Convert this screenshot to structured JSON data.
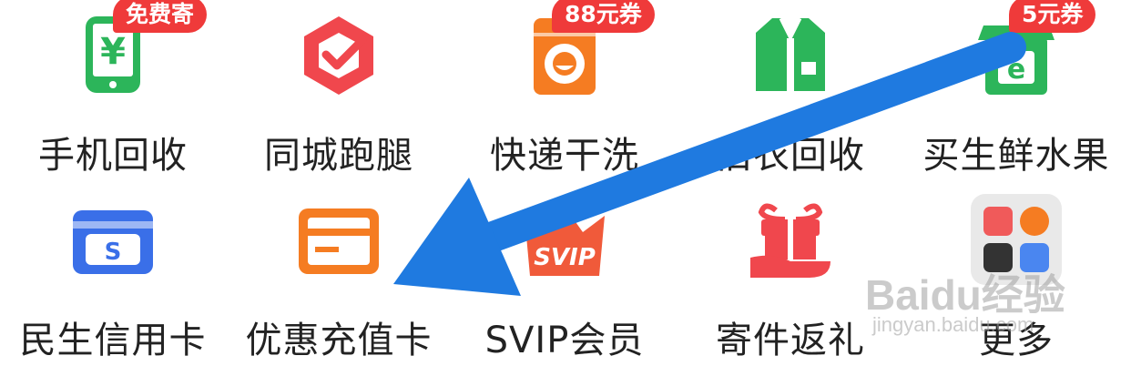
{
  "grid": {
    "items": [
      {
        "label": "手机回收",
        "badge": "免费寄",
        "icon": "phone-yuan-icon",
        "color": "#2cb55a"
      },
      {
        "label": "同城跑腿",
        "badge": "",
        "icon": "hexagon-check-icon",
        "color": "#f0474d"
      },
      {
        "label": "快递干洗",
        "badge": "88元券",
        "icon": "washing-machine-icon",
        "color": "#f57c22"
      },
      {
        "label": "旧衣回收",
        "badge": "",
        "icon": "shirt-icon",
        "color": "#2cb55a"
      },
      {
        "label": "买生鲜水果",
        "badge": "5元券",
        "icon": "fresh-bag-icon",
        "color": "#2cb55a"
      },
      {
        "label": "民生信用卡",
        "badge": "",
        "icon": "credit-card-icon",
        "color": "#3a6fe8"
      },
      {
        "label": "优惠充值卡",
        "badge": "",
        "icon": "recharge-card-icon",
        "color": "#f57c22"
      },
      {
        "label": "SVIP会员",
        "badge": "",
        "icon": "svip-crown-icon",
        "color": "#f05a3a"
      },
      {
        "label": "寄件返礼",
        "badge": "",
        "icon": "gift-hand-icon",
        "color": "#f0474d"
      },
      {
        "label": "更多",
        "badge": "",
        "icon": "more-apps-icon",
        "color": "#e9e9e9"
      }
    ]
  },
  "annotation": {
    "arrow_color": "#1f7ae0"
  },
  "watermark": {
    "logo": "Baidu经验",
    "url": "jingyan.baidu.com"
  }
}
